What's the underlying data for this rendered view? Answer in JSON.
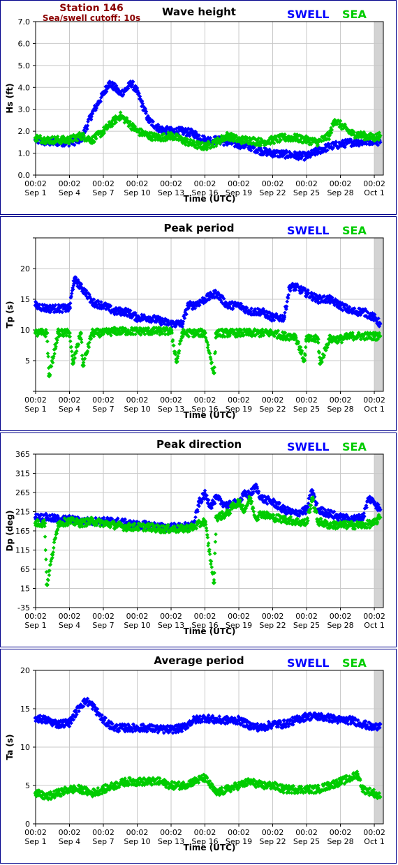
{
  "station": {
    "name": "Station 146",
    "cutoff": "Sea/swell cutoff: 10s"
  },
  "legend": {
    "swell_label": "SWELL",
    "sea_label": "SEA",
    "swell_color": "#0000ff",
    "sea_color": "#00cc00"
  },
  "x_axis": {
    "label": "Time (UTC)",
    "tick_time": "00:02",
    "ticks": [
      "Sep 1",
      "Sep 4",
      "Sep 7",
      "Sep 10",
      "Sep 13",
      "Sep 16",
      "Sep 19",
      "Sep 22",
      "Sep 25",
      "Sep 28",
      "Oct 1"
    ],
    "tick_days": [
      0,
      3,
      6,
      9,
      12,
      15,
      18,
      21,
      24,
      27,
      30
    ],
    "range_days": [
      0,
      30.8
    ],
    "grid": true
  },
  "chart_data": [
    {
      "type": "scatter",
      "title": "Wave height",
      "ylabel": "Hs (ft)",
      "ylim": [
        0,
        7
      ],
      "yticks": [
        "0.0",
        "1.0",
        "2.0",
        "3.0",
        "4.0",
        "5.0",
        "6.0",
        "7.0"
      ],
      "series": [
        {
          "name": "SWELL",
          "x": [
            0,
            1,
            2,
            3,
            4,
            5,
            6,
            6.5,
            7,
            7.5,
            8,
            8.5,
            9,
            10,
            11,
            12,
            13,
            14,
            15,
            16,
            17,
            18,
            19,
            20,
            21,
            22,
            23,
            24,
            25,
            26,
            27,
            28,
            29,
            30,
            30.5
          ],
          "values": [
            1.6,
            1.5,
            1.5,
            1.5,
            1.6,
            2.8,
            3.7,
            4.2,
            4.0,
            3.7,
            3.9,
            4.2,
            3.8,
            2.5,
            2.1,
            2.0,
            2.0,
            1.9,
            1.6,
            1.6,
            1.5,
            1.4,
            1.3,
            1.1,
            1.0,
            0.95,
            0.9,
            0.85,
            1.1,
            1.3,
            1.4,
            1.5,
            1.5,
            1.6,
            1.5
          ]
        },
        {
          "name": "SEA",
          "x": [
            0,
            1,
            2,
            3,
            4,
            5,
            6,
            7,
            7.5,
            8,
            9,
            10,
            11,
            12,
            13,
            14,
            15,
            16,
            17,
            18,
            19,
            20,
            21,
            22,
            23,
            24,
            25,
            26,
            26.5,
            27,
            28,
            29,
            30,
            30.5
          ],
          "values": [
            1.7,
            1.6,
            1.6,
            1.6,
            1.8,
            1.6,
            2.0,
            2.5,
            2.7,
            2.5,
            2.0,
            1.8,
            1.7,
            1.8,
            1.6,
            1.4,
            1.3,
            1.5,
            1.8,
            1.6,
            1.6,
            1.5,
            1.6,
            1.7,
            1.7,
            1.6,
            1.5,
            1.8,
            2.5,
            2.3,
            1.9,
            1.8,
            1.7,
            1.8
          ]
        }
      ]
    },
    {
      "type": "scatter",
      "title": "Peak period",
      "ylabel": "Tp (s)",
      "ylim": [
        0,
        25
      ],
      "yticks": [
        "",
        "5",
        "10",
        "15",
        "20",
        ""
      ],
      "series": [
        {
          "name": "SWELL",
          "x": [
            0,
            1,
            2,
            3,
            3.4,
            3.6,
            4,
            4.5,
            5,
            6,
            7,
            8,
            9,
            10,
            11,
            12,
            13,
            13.5,
            14,
            15,
            16,
            17,
            18,
            19,
            20,
            21,
            22,
            22.5,
            23,
            24,
            25,
            26,
            27,
            28,
            29,
            30,
            30.5
          ],
          "values": [
            14,
            13.5,
            13.5,
            13.5,
            18,
            18,
            17,
            16,
            14.5,
            14,
            13,
            13,
            12,
            12,
            11.5,
            11,
            11,
            14,
            14,
            15,
            16,
            14,
            14,
            13,
            13,
            12,
            12,
            17,
            17,
            16,
            15,
            15,
            14,
            13,
            13,
            12,
            11
          ]
        },
        {
          "name": "SEA",
          "x": [
            0,
            0.5,
            1,
            1.2,
            2,
            3,
            3.3,
            4,
            4.2,
            5,
            6,
            7,
            8,
            9,
            10,
            11,
            12,
            12.5,
            13,
            14,
            15,
            15.8,
            16,
            17,
            18,
            19,
            20,
            21,
            22,
            23,
            23.8,
            24,
            25,
            25.2,
            26,
            27,
            28,
            29,
            30,
            30.5
          ],
          "values": [
            9.5,
            9.5,
            9.5,
            2.5,
            9.5,
            9.5,
            4.5,
            9.5,
            4.2,
            9.5,
            9.5,
            9.8,
            9.8,
            9.8,
            9.8,
            9.8,
            9.8,
            4.8,
            9.5,
            9.5,
            9.5,
            3,
            9.5,
            9.5,
            9.5,
            9.5,
            9.5,
            9.5,
            9,
            9,
            5,
            8.5,
            8.5,
            4.5,
            8.5,
            8.5,
            9,
            9,
            9,
            9
          ]
        }
      ]
    },
    {
      "type": "scatter",
      "title": "Peak direction",
      "ylabel": "Dp (deg)",
      "ylim": [
        -35,
        365
      ],
      "yticks": [
        "-35",
        "15",
        "65",
        "115",
        "165",
        "215",
        "265",
        "315",
        "365"
      ],
      "series": [
        {
          "name": "SWELL",
          "x": [
            0,
            1,
            2,
            3,
            4,
            5,
            6,
            7,
            8,
            9,
            10,
            11,
            12,
            13,
            14,
            14.5,
            15,
            15.5,
            16,
            17,
            18,
            18.5,
            19,
            19.5,
            20,
            21,
            22,
            23,
            24,
            24.5,
            25,
            26,
            27,
            28,
            29,
            29.5,
            30,
            30.5
          ],
          "values": [
            200,
            200,
            195,
            195,
            190,
            190,
            190,
            190,
            185,
            180,
            180,
            175,
            175,
            175,
            180,
            240,
            260,
            230,
            250,
            230,
            240,
            260,
            260,
            280,
            250,
            240,
            220,
            210,
            220,
            270,
            220,
            210,
            200,
            195,
            200,
            250,
            240,
            220
          ]
        },
        {
          "name": "SEA",
          "x": [
            0,
            0.8,
            1,
            2,
            3,
            4,
            5,
            6,
            7,
            8,
            9,
            10,
            11,
            12,
            13,
            14,
            15,
            15.8,
            16,
            17,
            17.5,
            18,
            18.5,
            19,
            19.5,
            20,
            21,
            22,
            23,
            24,
            24.5,
            25,
            26,
            27,
            28,
            29,
            30,
            30.5
          ],
          "values": [
            185,
            185,
            25,
            185,
            190,
            185,
            190,
            185,
            180,
            175,
            175,
            175,
            170,
            170,
            170,
            175,
            190,
            30,
            200,
            210,
            230,
            240,
            220,
            250,
            200,
            210,
            200,
            195,
            190,
            185,
            250,
            190,
            180,
            180,
            180,
            180,
            185,
            200
          ]
        }
      ]
    },
    {
      "type": "scatter",
      "title": "Average period",
      "ylabel": "Ta (s)",
      "ylim": [
        0,
        20
      ],
      "yticks": [
        "0",
        "5",
        "10",
        "15",
        "20"
      ],
      "series": [
        {
          "name": "SWELL",
          "x": [
            0,
            1,
            2,
            3,
            4,
            4.5,
            5,
            6,
            7,
            8,
            9,
            10,
            11,
            12,
            13,
            14,
            15,
            16,
            17,
            18,
            19,
            20,
            21,
            22,
            23,
            24,
            25,
            26,
            27,
            28,
            29,
            30,
            30.5
          ],
          "values": [
            13.8,
            13.5,
            13.0,
            13.2,
            15.5,
            16.0,
            15.5,
            13.5,
            12.5,
            12.5,
            12.5,
            12.5,
            12.3,
            12.3,
            12.5,
            13.5,
            13.8,
            13.5,
            13.5,
            13.5,
            12.8,
            12.5,
            13.0,
            13.0,
            13.5,
            14.0,
            14.0,
            13.8,
            13.5,
            13.5,
            13.0,
            12.5,
            13.0
          ]
        },
        {
          "name": "SEA",
          "x": [
            0,
            1,
            2,
            3,
            4,
            5,
            6,
            7,
            8,
            9,
            10,
            11,
            12,
            13,
            14,
            15,
            16,
            17,
            18,
            19,
            20,
            21,
            22,
            23,
            24,
            25,
            26,
            27,
            28,
            28.5,
            29,
            30,
            30.5
          ],
          "values": [
            4.0,
            3.5,
            4.0,
            4.5,
            4.5,
            4.0,
            4.5,
            5.0,
            5.5,
            5.5,
            5.5,
            5.5,
            5.0,
            5.0,
            5.5,
            6.0,
            4.0,
            4.5,
            5.0,
            5.5,
            5.0,
            5.0,
            4.5,
            4.5,
            4.5,
            4.5,
            5.0,
            5.5,
            6.0,
            6.5,
            4.5,
            4.0,
            3.5
          ]
        }
      ]
    }
  ]
}
